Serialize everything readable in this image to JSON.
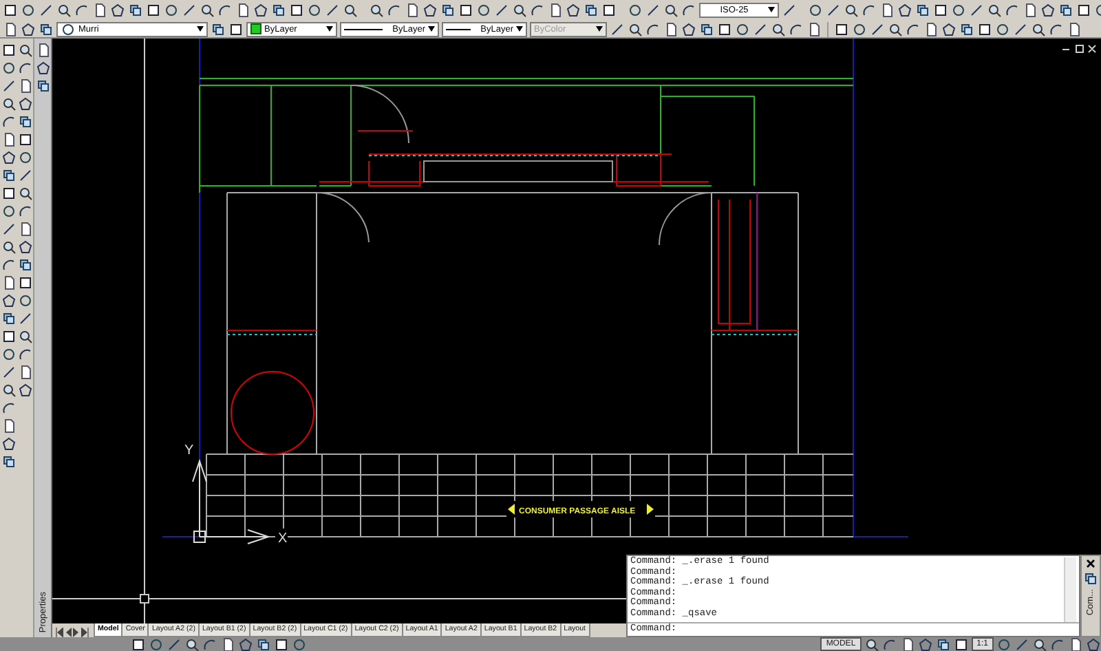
{
  "toolbars": {
    "dimstyle": "ISO-25",
    "layer": "Murri",
    "color_setting": "ByLayer",
    "linetype": "ByLayer",
    "lineweight": "ByLayer",
    "plotstyle": {
      "value": "ByColor",
      "disabled": true
    }
  },
  "palette": {
    "title": "Properties"
  },
  "drawing": {
    "label": "CONSUMER PASSAGE AISLE",
    "ucs_x": "X",
    "ucs_y": "Y"
  },
  "layout_tabs": [
    {
      "label": "Model",
      "selected": true
    },
    {
      "label": "Cover",
      "selected": false
    },
    {
      "label": "Layout A2 (2)",
      "selected": false
    },
    {
      "label": "Layout B1 (2)",
      "selected": false
    },
    {
      "label": "Layout B2 (2)",
      "selected": false
    },
    {
      "label": "Layout C1 (2)",
      "selected": false
    },
    {
      "label": "Layout C2 (2)",
      "selected": false
    },
    {
      "label": "Layout A1",
      "selected": false
    },
    {
      "label": "Layout A2",
      "selected": false
    },
    {
      "label": "Layout B1",
      "selected": false
    },
    {
      "label": "Layout B2",
      "selected": false
    },
    {
      "label": "Layout",
      "selected": false
    }
  ],
  "command_window": {
    "history": [
      "Command: _.erase 1 found",
      "Command:",
      "Command: _.erase 1 found",
      "Command:",
      "Command:",
      "Command: _qsave"
    ],
    "prompt": "Command:",
    "side_title": "Com..."
  },
  "status_bar": {
    "space": "MODEL",
    "scale": "1:1"
  }
}
